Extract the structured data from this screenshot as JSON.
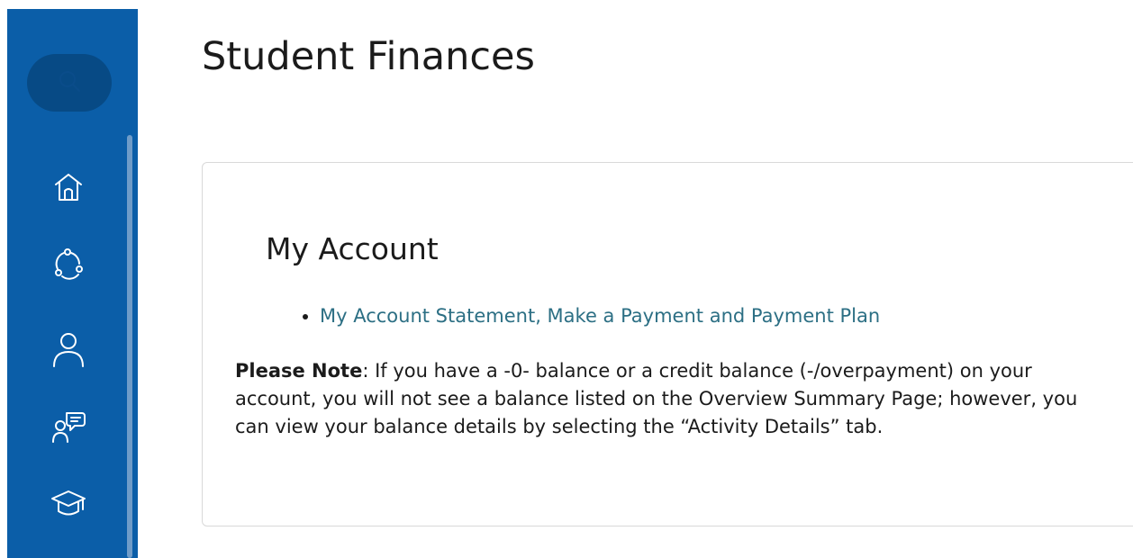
{
  "sidebar": {
    "icons": [
      {
        "name": "search-icon"
      },
      {
        "name": "home-icon"
      },
      {
        "name": "network-icon"
      },
      {
        "name": "profile-icon"
      },
      {
        "name": "advisor-chat-icon"
      },
      {
        "name": "graduation-cap-icon"
      }
    ]
  },
  "page": {
    "title": "Student Finances"
  },
  "card": {
    "title": "My Account",
    "links": [
      {
        "label": "My Account Statement, Make a Payment and Payment Plan"
      }
    ],
    "note": {
      "label": "Please Note",
      "separator": ":",
      "text": " If you have a -0- balance or a credit balance (-/overpayment) on your account, you will not see a balance listed on the Overview Summary Page; however, you can view your balance details by selecting the “Activity Details” tab."
    }
  },
  "colors": {
    "sidebar": "#0b5ea8",
    "search_button": "#074a85",
    "link": "#2c6f84"
  }
}
